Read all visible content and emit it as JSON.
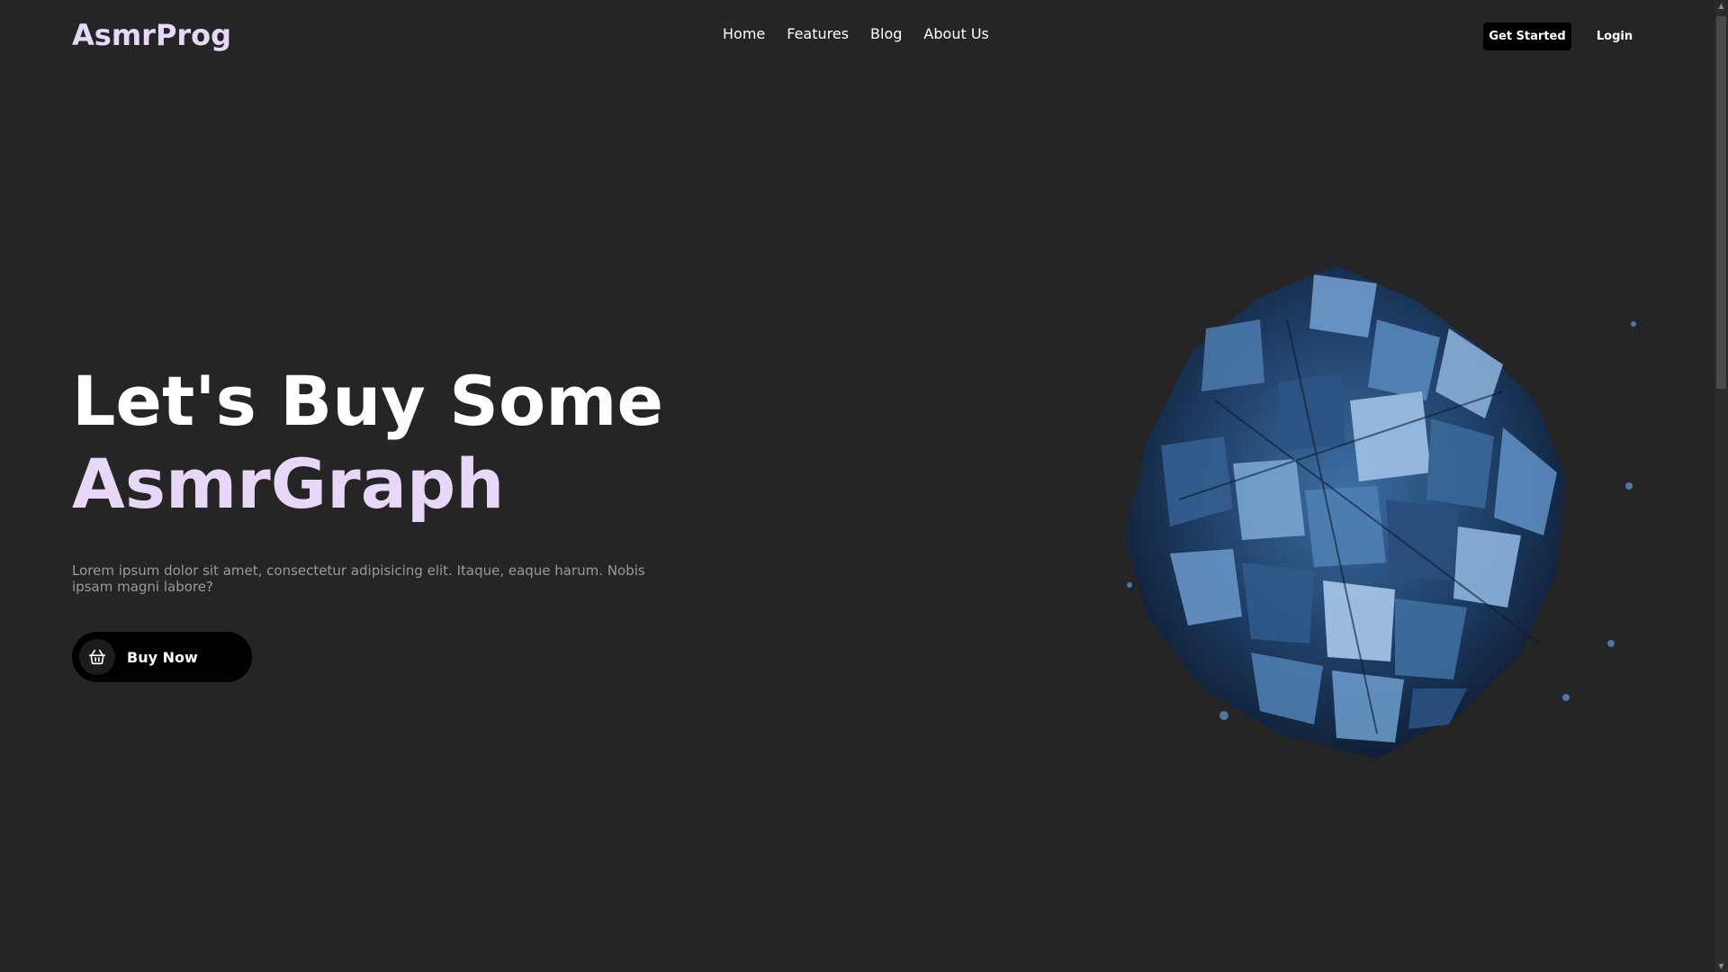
{
  "header": {
    "logo": "AsmrProg",
    "nav": [
      "Home",
      "Features",
      "Blog",
      "About Us"
    ],
    "get_started": "Get Started",
    "login": "Login"
  },
  "hero": {
    "title_line1": "Let's Buy Some",
    "title_line2": "AsmrGraph",
    "description": "Lorem ipsum dolor sit amet, consectetur adipisicing elit. Itaque, eaque harum. Nobis ipsam magni labore?",
    "buy_button": "Buy Now"
  },
  "colors": {
    "background": "#252525",
    "accent": "#e8d8f8",
    "button_bg": "#000000",
    "muted_text": "#9a9a9a"
  },
  "icons": {
    "buy": "basket-icon",
    "hero_image": "crystal-sphere-image"
  }
}
